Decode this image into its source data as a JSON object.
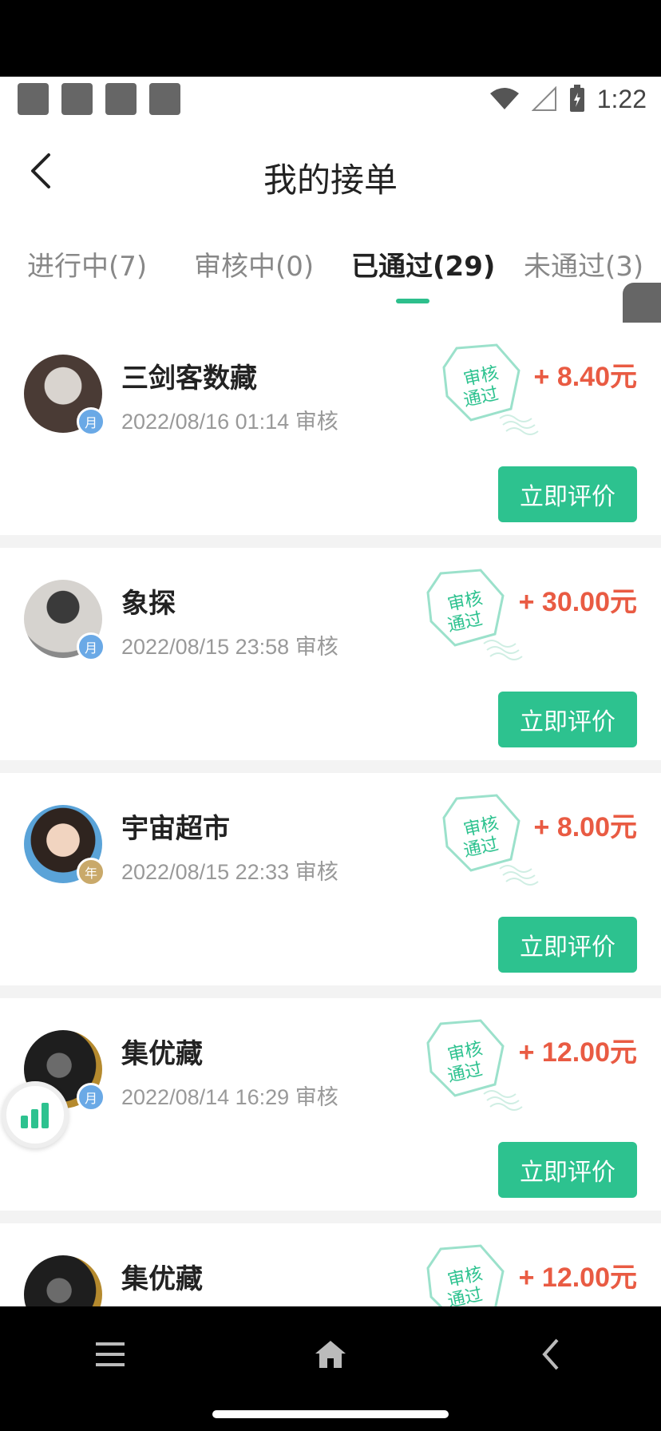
{
  "status_bar": {
    "time": "1:22"
  },
  "header": {
    "title": "我的接单",
    "back_icon": "chevron-left-icon"
  },
  "tabs": [
    {
      "label": "进行中(7)",
      "active": false
    },
    {
      "label": "审核中(0)",
      "active": false
    },
    {
      "label": "已通过(29)",
      "active": true
    },
    {
      "label": "未通过(3)",
      "active": false
    }
  ],
  "stamp_text": {
    "line1": "审核",
    "line2": "通过"
  },
  "accent_color": "#2dc28f",
  "amount_color": "#e95b43",
  "orders": [
    {
      "name": "三剑客数藏",
      "time": "2022/08/16 01:14 审核",
      "amount": "+ 8.40元",
      "badge": "月",
      "button": "立即评价"
    },
    {
      "name": "象探",
      "time": "2022/08/15 23:58 审核",
      "amount": "+ 30.00元",
      "badge": "月",
      "button": "立即评价"
    },
    {
      "name": "宇宙超市",
      "time": "2022/08/15 22:33 审核",
      "amount": "+ 8.00元",
      "badge": "年",
      "button": "立即评价"
    },
    {
      "name": "集优藏",
      "time": "2022/08/14 16:29 审核",
      "amount": "+ 12.00元",
      "badge": "月",
      "button": "立即评价"
    },
    {
      "name": "集优藏",
      "time": "",
      "amount": "+ 12.00元",
      "badge": "",
      "button": ""
    }
  ],
  "navbar": {
    "menu_icon": "menu-icon",
    "home_icon": "home-icon",
    "back_icon": "back-icon"
  }
}
